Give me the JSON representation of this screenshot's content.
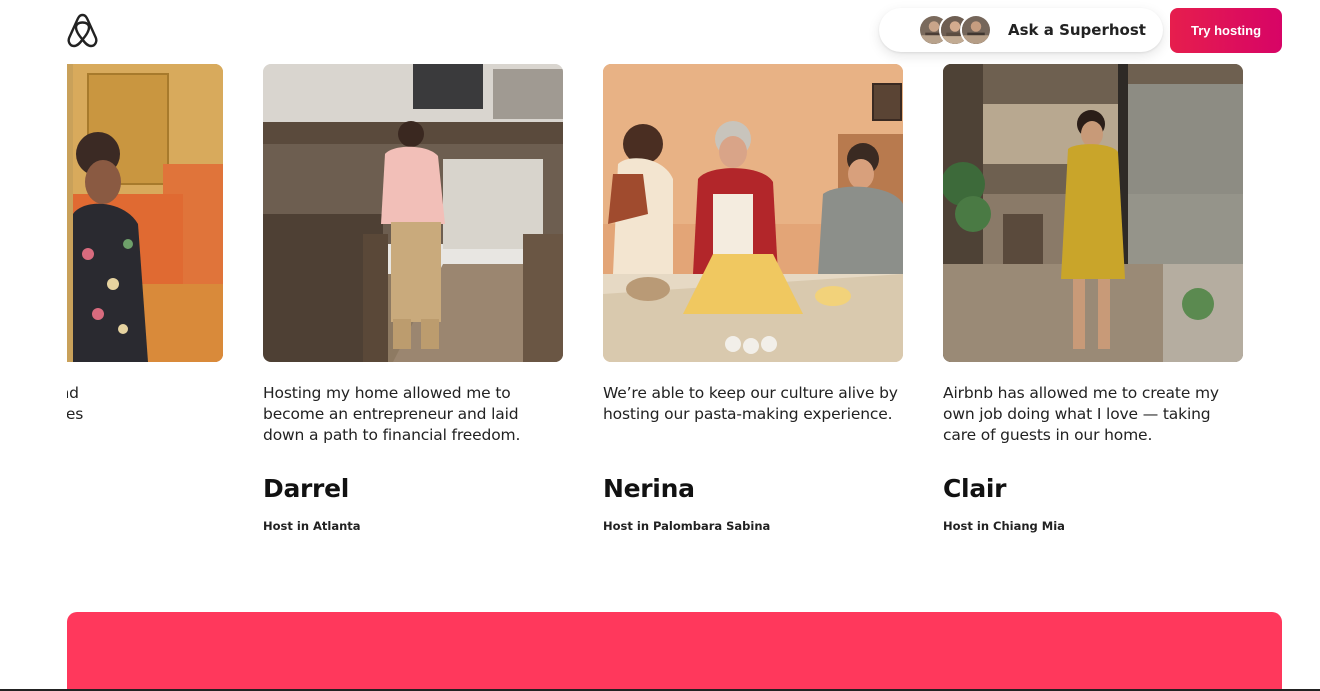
{
  "header": {
    "logo_icon": "airbnb-belo-icon",
    "superhost_label": "Ask a Superhost",
    "try_hosting_label": "Try hosting"
  },
  "colors": {
    "brand": "#ff385c",
    "button_gradient_start": "#e61e4d",
    "button_gradient_end": "#d70466"
  },
  "cards": [
    {
      "quote": "changed my life and\nmorable experiences",
      "name": "",
      "location": ""
    },
    {
      "quote": "Hosting my home allowed me to become an entrepreneur and laid down a path to financial freedom.",
      "name": "Darrel",
      "location": "Host in Atlanta"
    },
    {
      "quote": "We’re able to keep our culture alive by hosting our pasta-making experience.",
      "name": "Nerina",
      "location": "Host in Palombara Sabina"
    },
    {
      "quote": "Airbnb has allowed me to create my own job doing what I love — taking care of guests in our home.",
      "name": "Clair",
      "location": "Host in Chiang Mia"
    }
  ]
}
